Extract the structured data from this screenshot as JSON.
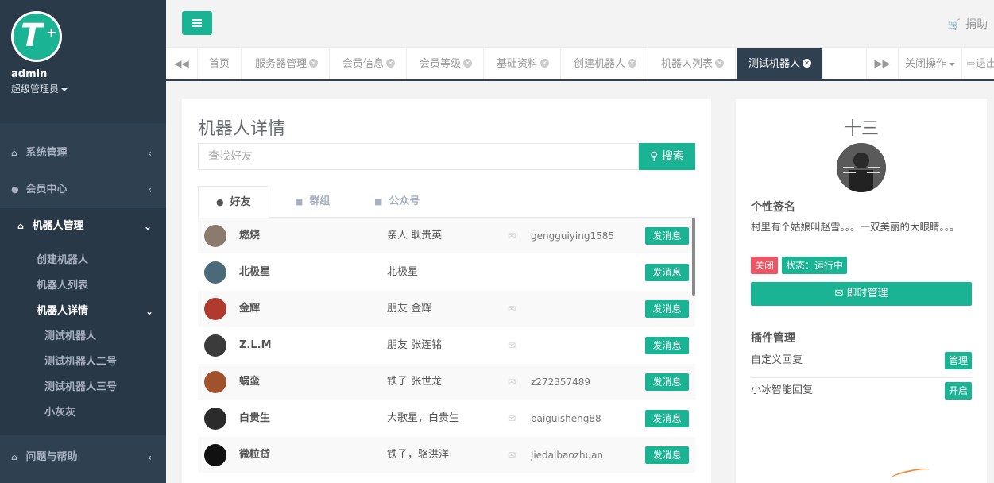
{
  "sidebar": {
    "username": "admin",
    "role": "超级管理员",
    "menu": [
      {
        "label": "系统管理"
      },
      {
        "label": "会员中心"
      },
      {
        "label": "机器人管理"
      },
      {
        "label": "问题与帮助"
      }
    ],
    "submenu": [
      "创建机器人",
      "机器人列表",
      "机器人详情"
    ],
    "subsubmenu": [
      "测试机器人",
      "测试机器人二号",
      "测试机器人三号",
      "小灰灰"
    ]
  },
  "topbar": {
    "donate_label": "捐助"
  },
  "tabs": {
    "items": [
      "首页",
      "服务器管理",
      "会员信息",
      "会员等级",
      "基础资料",
      "创建机器人",
      "机器人列表",
      "测试机器人"
    ],
    "close_ops": "关闭操作",
    "logout": "退出"
  },
  "main": {
    "title": "机器人详情",
    "search_placeholder": "查找好友",
    "search_button": "搜索",
    "tabs": [
      "好友",
      "群组",
      "公众号"
    ],
    "send_label": "发消息",
    "friends": [
      {
        "name": "燃烧",
        "remark": "亲人 耿贵英",
        "email": "gengguiying1585"
      },
      {
        "name": "北极星",
        "remark": "北极星",
        "email": ""
      },
      {
        "name": "金辉",
        "remark": "朋友 金辉",
        "email": ""
      },
      {
        "name": "Z.L.M",
        "remark": "朋友 张连铭",
        "email": ""
      },
      {
        "name": "蜗蛮",
        "remark": "铁子 张世龙",
        "email": "z272357489"
      },
      {
        "name": "白贵生",
        "remark": "大歌星，白贵生",
        "email": "baiguisheng88"
      },
      {
        "name": "微粒贷",
        "remark": "铁子，骆洪洋",
        "email": "jiedaibaozhuan"
      }
    ]
  },
  "profile": {
    "name": "十三",
    "signature_title": "个性签名",
    "signature": "村里有个姑娘叫赵雪。。。一双美丽的大眼睛。。。",
    "badge_off": "关闭",
    "badge_status": "状态：运行中",
    "manage_button": "即时管理",
    "plugin_title": "插件管理",
    "plugins": [
      {
        "name": "自定义回复",
        "action": "管理"
      },
      {
        "name": "小冰智能回复",
        "action": "开启"
      }
    ]
  },
  "colors": {
    "accent": "#1ab394",
    "sidebar": "#2f4050",
    "danger": "#ed5565"
  }
}
